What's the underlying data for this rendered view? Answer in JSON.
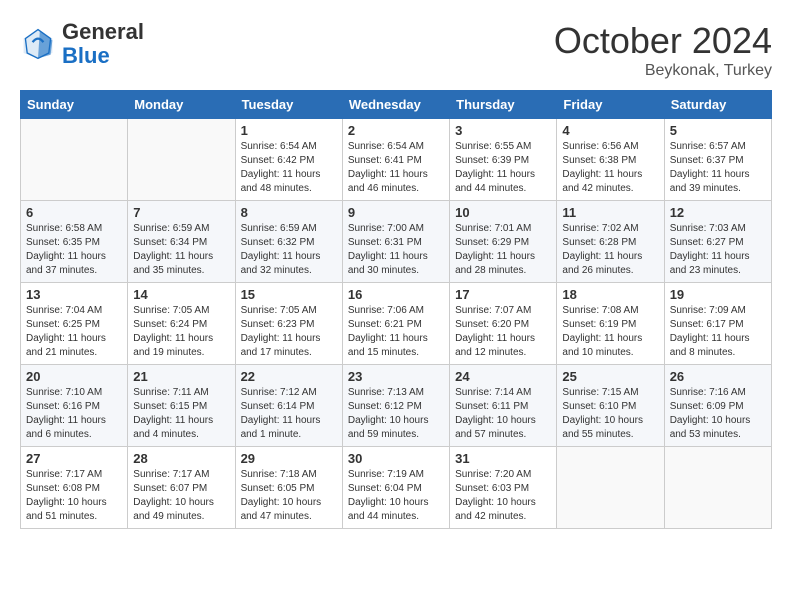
{
  "header": {
    "logo_general": "General",
    "logo_blue": "Blue",
    "month_title": "October 2024",
    "subtitle": "Beykonak, Turkey"
  },
  "days_of_week": [
    "Sunday",
    "Monday",
    "Tuesday",
    "Wednesday",
    "Thursday",
    "Friday",
    "Saturday"
  ],
  "weeks": [
    [
      {
        "day": "",
        "info": ""
      },
      {
        "day": "",
        "info": ""
      },
      {
        "day": "1",
        "info": "Sunrise: 6:54 AM\nSunset: 6:42 PM\nDaylight: 11 hours and 48 minutes."
      },
      {
        "day": "2",
        "info": "Sunrise: 6:54 AM\nSunset: 6:41 PM\nDaylight: 11 hours and 46 minutes."
      },
      {
        "day": "3",
        "info": "Sunrise: 6:55 AM\nSunset: 6:39 PM\nDaylight: 11 hours and 44 minutes."
      },
      {
        "day": "4",
        "info": "Sunrise: 6:56 AM\nSunset: 6:38 PM\nDaylight: 11 hours and 42 minutes."
      },
      {
        "day": "5",
        "info": "Sunrise: 6:57 AM\nSunset: 6:37 PM\nDaylight: 11 hours and 39 minutes."
      }
    ],
    [
      {
        "day": "6",
        "info": "Sunrise: 6:58 AM\nSunset: 6:35 PM\nDaylight: 11 hours and 37 minutes."
      },
      {
        "day": "7",
        "info": "Sunrise: 6:59 AM\nSunset: 6:34 PM\nDaylight: 11 hours and 35 minutes."
      },
      {
        "day": "8",
        "info": "Sunrise: 6:59 AM\nSunset: 6:32 PM\nDaylight: 11 hours and 32 minutes."
      },
      {
        "day": "9",
        "info": "Sunrise: 7:00 AM\nSunset: 6:31 PM\nDaylight: 11 hours and 30 minutes."
      },
      {
        "day": "10",
        "info": "Sunrise: 7:01 AM\nSunset: 6:29 PM\nDaylight: 11 hours and 28 minutes."
      },
      {
        "day": "11",
        "info": "Sunrise: 7:02 AM\nSunset: 6:28 PM\nDaylight: 11 hours and 26 minutes."
      },
      {
        "day": "12",
        "info": "Sunrise: 7:03 AM\nSunset: 6:27 PM\nDaylight: 11 hours and 23 minutes."
      }
    ],
    [
      {
        "day": "13",
        "info": "Sunrise: 7:04 AM\nSunset: 6:25 PM\nDaylight: 11 hours and 21 minutes."
      },
      {
        "day": "14",
        "info": "Sunrise: 7:05 AM\nSunset: 6:24 PM\nDaylight: 11 hours and 19 minutes."
      },
      {
        "day": "15",
        "info": "Sunrise: 7:05 AM\nSunset: 6:23 PM\nDaylight: 11 hours and 17 minutes."
      },
      {
        "day": "16",
        "info": "Sunrise: 7:06 AM\nSunset: 6:21 PM\nDaylight: 11 hours and 15 minutes."
      },
      {
        "day": "17",
        "info": "Sunrise: 7:07 AM\nSunset: 6:20 PM\nDaylight: 11 hours and 12 minutes."
      },
      {
        "day": "18",
        "info": "Sunrise: 7:08 AM\nSunset: 6:19 PM\nDaylight: 11 hours and 10 minutes."
      },
      {
        "day": "19",
        "info": "Sunrise: 7:09 AM\nSunset: 6:17 PM\nDaylight: 11 hours and 8 minutes."
      }
    ],
    [
      {
        "day": "20",
        "info": "Sunrise: 7:10 AM\nSunset: 6:16 PM\nDaylight: 11 hours and 6 minutes."
      },
      {
        "day": "21",
        "info": "Sunrise: 7:11 AM\nSunset: 6:15 PM\nDaylight: 11 hours and 4 minutes."
      },
      {
        "day": "22",
        "info": "Sunrise: 7:12 AM\nSunset: 6:14 PM\nDaylight: 11 hours and 1 minute."
      },
      {
        "day": "23",
        "info": "Sunrise: 7:13 AM\nSunset: 6:12 PM\nDaylight: 10 hours and 59 minutes."
      },
      {
        "day": "24",
        "info": "Sunrise: 7:14 AM\nSunset: 6:11 PM\nDaylight: 10 hours and 57 minutes."
      },
      {
        "day": "25",
        "info": "Sunrise: 7:15 AM\nSunset: 6:10 PM\nDaylight: 10 hours and 55 minutes."
      },
      {
        "day": "26",
        "info": "Sunrise: 7:16 AM\nSunset: 6:09 PM\nDaylight: 10 hours and 53 minutes."
      }
    ],
    [
      {
        "day": "27",
        "info": "Sunrise: 7:17 AM\nSunset: 6:08 PM\nDaylight: 10 hours and 51 minutes."
      },
      {
        "day": "28",
        "info": "Sunrise: 7:17 AM\nSunset: 6:07 PM\nDaylight: 10 hours and 49 minutes."
      },
      {
        "day": "29",
        "info": "Sunrise: 7:18 AM\nSunset: 6:05 PM\nDaylight: 10 hours and 47 minutes."
      },
      {
        "day": "30",
        "info": "Sunrise: 7:19 AM\nSunset: 6:04 PM\nDaylight: 10 hours and 44 minutes."
      },
      {
        "day": "31",
        "info": "Sunrise: 7:20 AM\nSunset: 6:03 PM\nDaylight: 10 hours and 42 minutes."
      },
      {
        "day": "",
        "info": ""
      },
      {
        "day": "",
        "info": ""
      }
    ]
  ]
}
